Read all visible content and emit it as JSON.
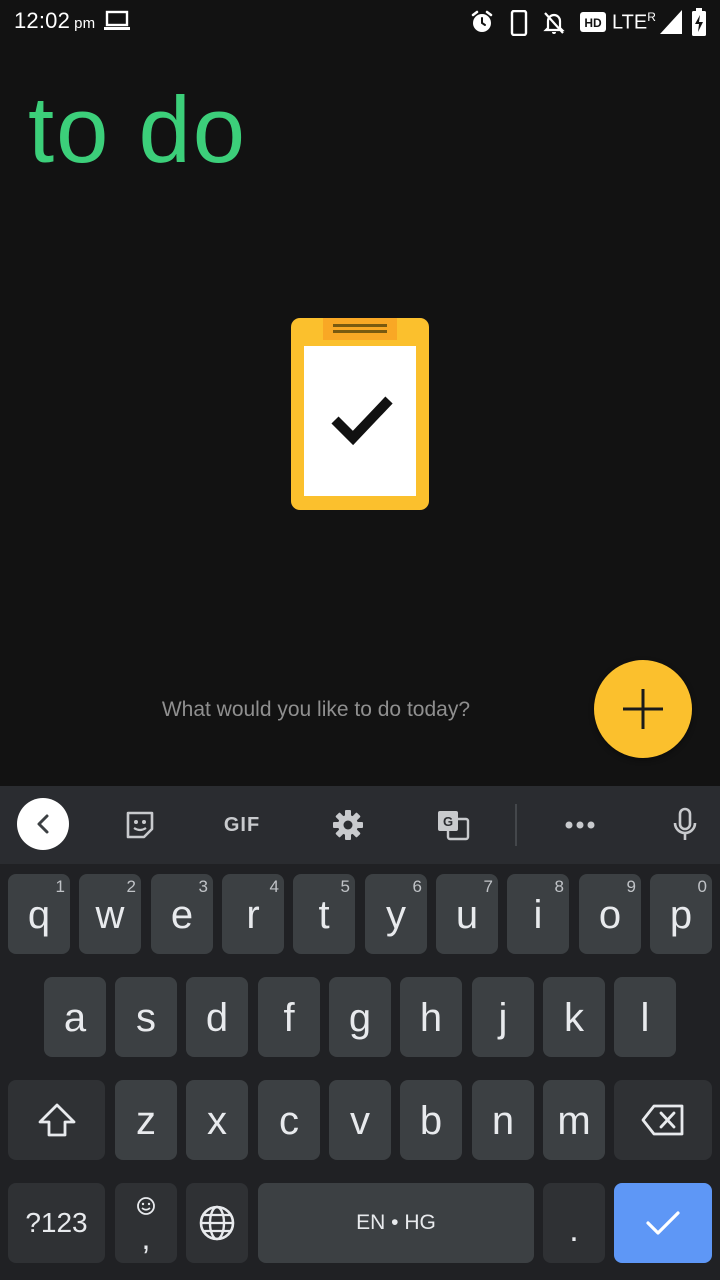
{
  "status": {
    "time": "12:02",
    "ampm": "pm",
    "network": "LTE",
    "roaming": "R",
    "hd": "HD"
  },
  "app": {
    "title": "to do",
    "prompt": "What would you like to do today?",
    "accent_color": "#3ccf7a",
    "fab_color": "#fbc02d"
  },
  "keyboard": {
    "toolbar": {
      "gif_label": "GIF"
    },
    "rows": [
      [
        {
          "label": "q",
          "hint": "1"
        },
        {
          "label": "w",
          "hint": "2"
        },
        {
          "label": "e",
          "hint": "3"
        },
        {
          "label": "r",
          "hint": "4"
        },
        {
          "label": "t",
          "hint": "5"
        },
        {
          "label": "y",
          "hint": "6"
        },
        {
          "label": "u",
          "hint": "7"
        },
        {
          "label": "i",
          "hint": "8"
        },
        {
          "label": "o",
          "hint": "9"
        },
        {
          "label": "p",
          "hint": "0"
        }
      ],
      [
        {
          "label": "a"
        },
        {
          "label": "s"
        },
        {
          "label": "d"
        },
        {
          "label": "f"
        },
        {
          "label": "g"
        },
        {
          "label": "h"
        },
        {
          "label": "j"
        },
        {
          "label": "k"
        },
        {
          "label": "l"
        }
      ],
      [
        {
          "label": "z"
        },
        {
          "label": "x"
        },
        {
          "label": "c"
        },
        {
          "label": "v"
        },
        {
          "label": "b"
        },
        {
          "label": "n"
        },
        {
          "label": "m"
        }
      ]
    ],
    "symbols_label": "?123",
    "comma_label": ",",
    "space_label": "EN • HG",
    "period_label": ".",
    "key_color": "#3c4043",
    "enter_color": "#5e97f6"
  }
}
